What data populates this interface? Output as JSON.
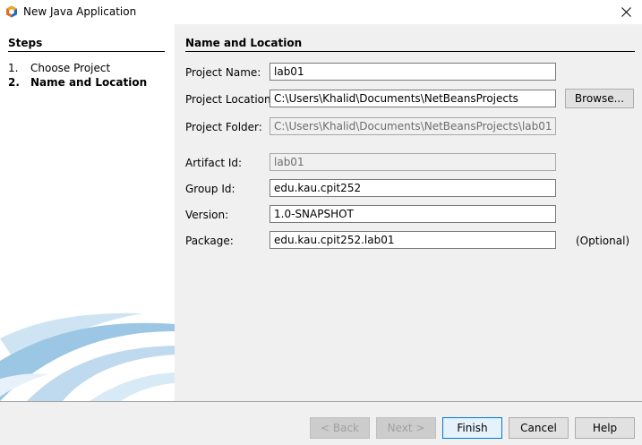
{
  "window": {
    "title": "New Java Application",
    "icon": "netbeans-cube-icon"
  },
  "steps": {
    "header": "Steps",
    "items": [
      {
        "num": "1.",
        "label": "Choose Project",
        "active": false
      },
      {
        "num": "2.",
        "label": "Name and Location",
        "active": true
      }
    ]
  },
  "form": {
    "section_title": "Name and Location",
    "project_name": {
      "label": "Project Name:",
      "value": "lab01"
    },
    "project_location": {
      "label": "Project Location:",
      "value": "C:\\Users\\Khalid\\Documents\\NetBeansProjects"
    },
    "browse_label": "Browse...",
    "project_folder": {
      "label": "Project Folder:",
      "value": "C:\\Users\\Khalid\\Documents\\NetBeansProjects\\lab01"
    },
    "artifact_id": {
      "label": "Artifact Id:",
      "value": "lab01"
    },
    "group_id": {
      "label": "Group Id:",
      "value": "edu.kau.cpit252"
    },
    "version": {
      "label": "Version:",
      "value": "1.0-SNAPSHOT"
    },
    "package": {
      "label": "Package:",
      "value": "edu.kau.cpit252.lab01"
    },
    "optional_label": "(Optional)"
  },
  "buttons": {
    "back": "< Back",
    "next": "Next >",
    "finish": "Finish",
    "cancel": "Cancel",
    "help": "Help"
  },
  "colors": {
    "accent": "#0078d7",
    "panel": "#f0f0f0",
    "swoosh": "#9cc7e4"
  }
}
